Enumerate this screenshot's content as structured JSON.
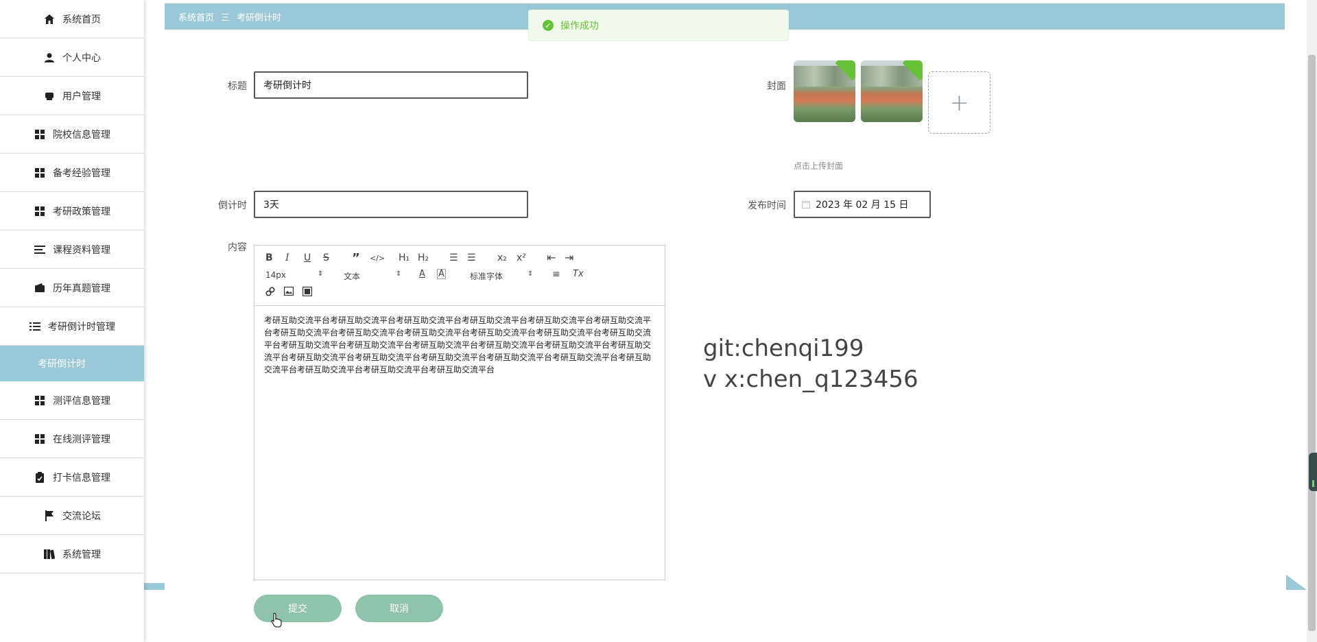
{
  "sidebar": {
    "items": [
      {
        "label": "系统首页",
        "icon": "home-icon"
      },
      {
        "label": "个人中心",
        "icon": "user-icon"
      },
      {
        "label": "用户管理",
        "icon": "users-icon"
      },
      {
        "label": "院校信息管理",
        "icon": "grid-icon"
      },
      {
        "label": "备考经验管理",
        "icon": "grid-icon"
      },
      {
        "label": "考研政策管理",
        "icon": "grid-icon"
      },
      {
        "label": "课程资料管理",
        "icon": "list-icon"
      },
      {
        "label": "历年真题管理",
        "icon": "wallet-icon"
      },
      {
        "label": "考研倒计时管理",
        "icon": "menu-icon"
      }
    ],
    "active_sub": "考研倒计时",
    "items2": [
      {
        "label": "测评信息管理",
        "icon": "grid-icon"
      },
      {
        "label": "在线测评管理",
        "icon": "grid-icon"
      },
      {
        "label": "打卡信息管理",
        "icon": "clipboard-icon"
      },
      {
        "label": "交流论坛",
        "icon": "flag-icon"
      },
      {
        "label": "系统管理",
        "icon": "book-icon"
      }
    ]
  },
  "breadcrumb": {
    "home": "系统首页",
    "sep": "三",
    "current": "考研倒计时"
  },
  "toast": {
    "text": "操作成功",
    "icon": "check-icon"
  },
  "form": {
    "title_label": "标题",
    "title_value": "考研倒计时",
    "cover_label": "封面",
    "cover_hint": "点击上传封面",
    "upload_plus": "+",
    "countdown_label": "倒计时",
    "countdown_value": "3天",
    "publish_label": "发布时间",
    "publish_value": "2023 年 02 月 15 日",
    "content_label": "内容",
    "content_text": "考研互助交流平台考研互助交流平台考研互助交流平台考研互助交流平台考研互助交流平台考研互助交流平台考研互助交流平台考研互助交流平台考研互助交流平台考研互助交流平台考研互助交流平台考研互助交流平台考研互助交流平台考研互助交流平台考研互助交流平台考研互助交流平台考研互助交流平台考研互助交流平台考研互助交流平台考研互助交流平台考研互助交流平台考研互助交流平台考研互助交流平台考研互助交流平台考研互助交流平台考研互助交流平台考研互助交流平台"
  },
  "toolbar": {
    "bold": "B",
    "italic": "I",
    "underline": "U",
    "strike": "S",
    "quote": "”",
    "code": "</>",
    "h1": "H₁",
    "h2": "H₂",
    "ol": "☰",
    "ul": "☰",
    "sub": "x₂",
    "sup": "x²",
    "outdent": "⇤",
    "indent": "⇥",
    "font_size": "14px",
    "text_type": "文本",
    "font_family": "标准字体",
    "color": "A",
    "bg": "A",
    "align": "≡",
    "clear": "Tx"
  },
  "watermark": {
    "line1": "git:chenqi199",
    "line2": "v x:chen_q123456"
  },
  "buttons": {
    "submit": "提交",
    "cancel": "取消"
  }
}
